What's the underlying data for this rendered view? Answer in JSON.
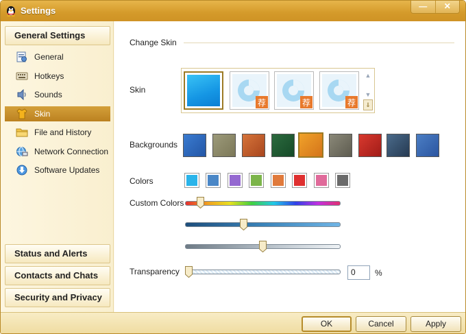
{
  "window": {
    "title": "Settings",
    "controls": [
      "—",
      "✕"
    ]
  },
  "sidebar": {
    "group_top": "General Settings",
    "items": [
      {
        "label": "General",
        "icon": "general-icon"
      },
      {
        "label": "Hotkeys",
        "icon": "keyboard-icon"
      },
      {
        "label": "Sounds",
        "icon": "speaker-icon"
      },
      {
        "label": "Skin",
        "icon": "shirt-icon",
        "selected": true
      },
      {
        "label": "File and History",
        "icon": "folder-icon"
      },
      {
        "label": "Network Connection",
        "icon": "network-icon"
      },
      {
        "label": "Software Updates",
        "icon": "download-icon"
      }
    ],
    "groups_bottom": [
      "Status and Alerts",
      "Contacts and Chats",
      "Security and Privacy"
    ]
  },
  "main": {
    "section_title": "Change Skin",
    "skin_label": "Skin",
    "skin_badge": "荐",
    "backgrounds_label": "Backgrounds",
    "colors_label": "Colors",
    "custom_colors_label": "Custom Colors",
    "transparency_label": "Transparency",
    "transparency_value": "0",
    "transparency_unit": "%",
    "color_swatches": [
      "#2ab4ea",
      "#4a87c7",
      "#9468d0",
      "#7cb54a",
      "#e07a3c",
      "#df3030",
      "#e06a9a",
      "#6a6a6a"
    ],
    "sliders": {
      "hue": 0.08,
      "saturation": 0.37,
      "lightness": 0.5,
      "transparency": 0
    }
  },
  "buttons": {
    "ok": "OK",
    "cancel": "Cancel",
    "apply": "Apply"
  },
  "colors": {
    "accent": "#d49a2a",
    "selected": "#bb8120"
  }
}
